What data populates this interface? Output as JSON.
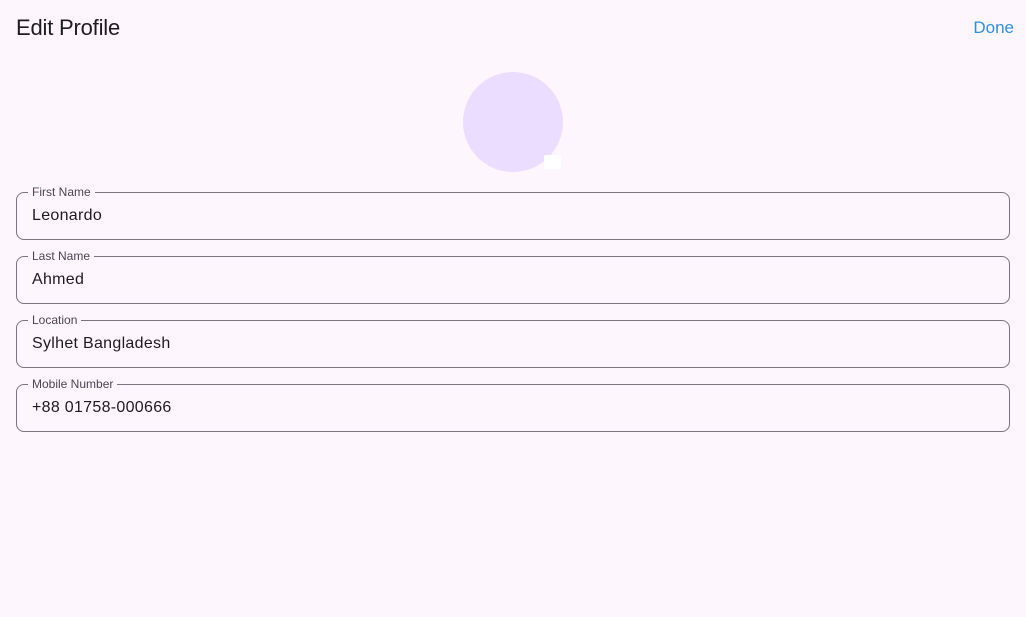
{
  "header": {
    "title": "Edit Profile",
    "done_label": "Done"
  },
  "form": {
    "fields": [
      {
        "label": "First Name",
        "value": "Leonardo"
      },
      {
        "label": "Last Name",
        "value": "Ahmed"
      },
      {
        "label": "Location",
        "value": "Sylhet Bangladesh"
      },
      {
        "label": "Mobile Number",
        "value": "+88 01758-000666"
      }
    ]
  },
  "colors": {
    "background": "#fdf7fd",
    "accent": "#2f8fd8",
    "avatar": "#eaddff",
    "outline": "#79747e"
  }
}
